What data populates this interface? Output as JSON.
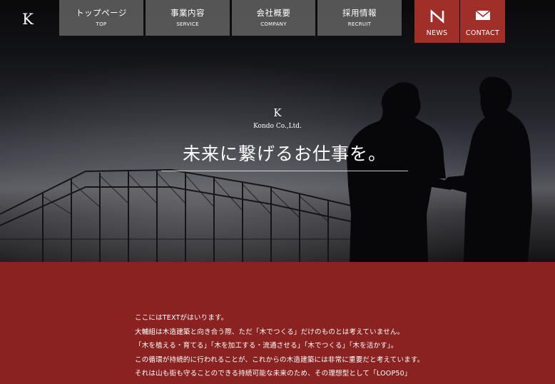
{
  "header": {
    "logo": "K",
    "nav": [
      {
        "jp": "トップページ",
        "en": "TOP"
      },
      {
        "jp": "事業内容",
        "en": "SERVICE"
      },
      {
        "jp": "会社概要",
        "en": "COMPANY"
      },
      {
        "jp": "採用情報",
        "en": "RECRUIT"
      }
    ],
    "news_label": "NEWS",
    "contact_label": "CONTACT"
  },
  "hero": {
    "logo_mark": "K",
    "company_name": "Kondo Co.,Ltd.",
    "tagline": "未来に繋げるお仕事を。"
  },
  "intro": {
    "lines": [
      "ここにはTEXTがはいります。",
      "大輔組は木造建築と向き合う際、ただ「木でつくる」だけのものとは考えていません。",
      "「木を植える・育てる」「木を加工する・流通させる」「木でつくる」「木を活かす」。",
      "この循環が持続的に行われることが、これからの木造建築には非常に重要だと考えています。",
      "それは山も街も守ることのできる持続可能な未来のため、その理想型として「LOOP50」"
    ]
  },
  "colors": {
    "nav_bg": "#5c5c5c",
    "accent_red": "#a02e29",
    "section_red": "#8b2222"
  },
  "icons": {
    "logo": "k-logo",
    "news": "n-letter-icon",
    "contact": "envelope-icon"
  }
}
